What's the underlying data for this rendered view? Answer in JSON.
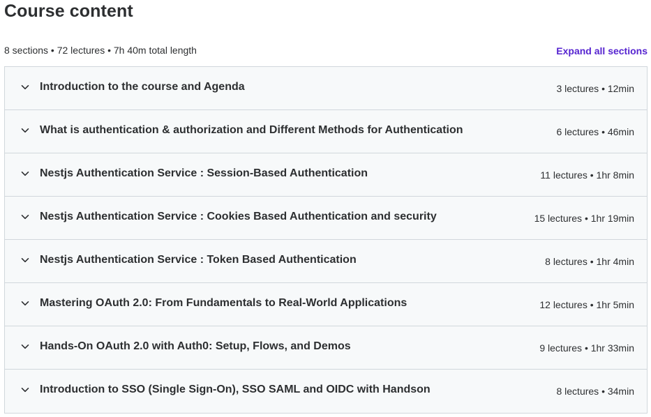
{
  "header": {
    "title": "Course content",
    "summary": "8 sections • 72 lectures • 7h 40m total length",
    "expand_label": "Expand all sections"
  },
  "colors": {
    "accent": "#5624d0",
    "section_bg": "#f7f9fa",
    "border": "#d1d7dc",
    "text": "#2d2f31"
  },
  "sections": [
    {
      "title": "Introduction to the course and Agenda",
      "meta": "3 lectures • 12min",
      "icon": "chevron-down-icon"
    },
    {
      "title": "What is authentication & authorization and Different Methods for Authentication",
      "meta": "6 lectures • 46min",
      "icon": "chevron-down-icon"
    },
    {
      "title": "Nestjs Authentication Service : Session-Based Authentication",
      "meta": "11 lectures • 1hr 8min",
      "icon": "chevron-down-icon"
    },
    {
      "title": "Nestjs Authentication Service : Cookies Based Authentication and security",
      "meta": "15 lectures • 1hr 19min",
      "icon": "chevron-down-icon"
    },
    {
      "title": "Nestjs Authentication Service : Token Based Authentication",
      "meta": "8 lectures • 1hr 4min",
      "icon": "chevron-down-icon"
    },
    {
      "title": "Mastering OAuth 2.0: From Fundamentals to Real-World Applications",
      "meta": "12 lectures • 1hr 5min",
      "icon": "chevron-down-icon"
    },
    {
      "title": "Hands-On OAuth 2.0 with Auth0: Setup, Flows, and Demos",
      "meta": "9 lectures • 1hr 33min",
      "icon": "chevron-down-icon"
    },
    {
      "title": "Introduction to SSO (Single Sign-On), SSO SAML and OIDC with Handson",
      "meta": "8 lectures • 34min",
      "icon": "chevron-down-icon"
    }
  ]
}
